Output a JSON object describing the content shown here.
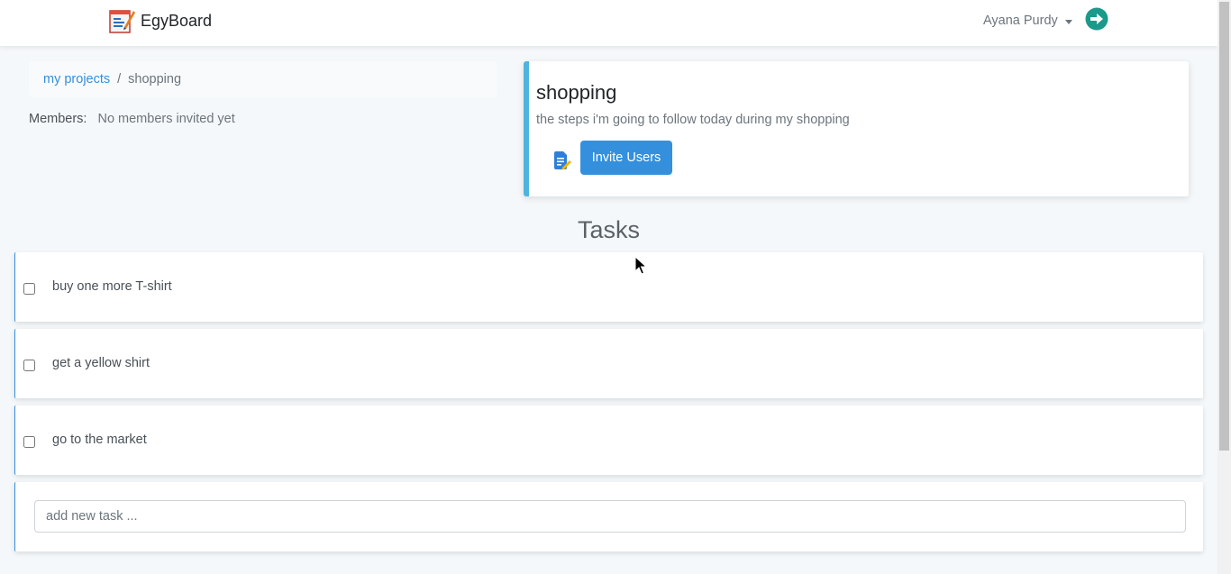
{
  "navbar": {
    "brand": "EgyBoard",
    "user_name": "Ayana Purdy",
    "logout_icon": "arrow-circle-right-icon"
  },
  "breadcrumb": {
    "root": "my projects",
    "separator": "/",
    "current": "shopping"
  },
  "members": {
    "label": "Members:",
    "value": "No members invited yet"
  },
  "project": {
    "title": "shopping",
    "description": "the steps i'm going to follow today during my shopping",
    "invite_label": "Invite Users",
    "accent_color": "#4fb3e0"
  },
  "tasks": {
    "heading": "Tasks",
    "items": [
      {
        "text": "buy one more T-shirt",
        "done": false
      },
      {
        "text": "get a yellow shirt",
        "done": false
      },
      {
        "text": "go to the market",
        "done": false
      }
    ],
    "new_task_placeholder": "add new task ..."
  },
  "colors": {
    "primary": "#3490dc",
    "logout": "#1a9a8a",
    "background": "#f5f8fa"
  }
}
